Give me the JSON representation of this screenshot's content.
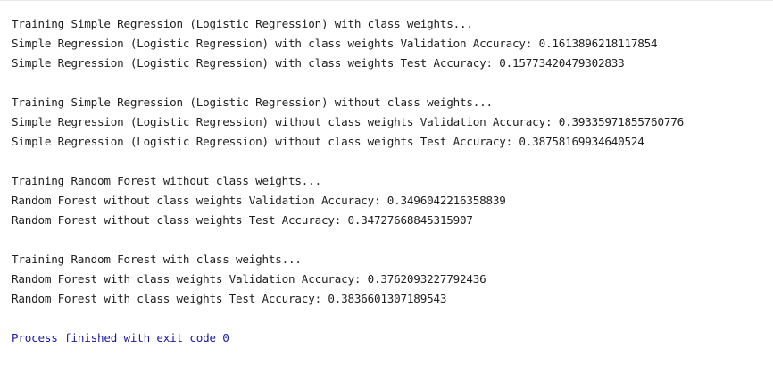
{
  "console": {
    "lines": [
      "Training Simple Regression (Logistic Regression) with class weights...",
      "Simple Regression (Logistic Regression) with class weights Validation Accuracy: 0.1613896218117854",
      "Simple Regression (Logistic Regression) with class weights Test Accuracy: 0.15773420479302833",
      "",
      "Training Simple Regression (Logistic Regression) without class weights...",
      "Simple Regression (Logistic Regression) without class weights Validation Accuracy: 0.39335971855760776",
      "Simple Regression (Logistic Regression) without class weights Test Accuracy: 0.38758169934640524",
      "",
      "Training Random Forest without class weights...",
      "Random Forest without class weights Validation Accuracy: 0.3496042216358839",
      "Random Forest without class weights Test Accuracy: 0.34727668845315907",
      "",
      "Training Random Forest with class weights...",
      "Random Forest with class weights Validation Accuracy: 0.3762093227792436",
      "Random Forest with class weights Test Accuracy: 0.3836601307189543",
      "",
      "Process finished with exit code 0"
    ],
    "exit_color": "#1a1aa0",
    "text_color": "#1f1f1f"
  }
}
